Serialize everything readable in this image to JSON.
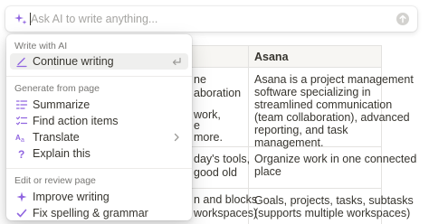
{
  "ai_bar": {
    "placeholder": "Ask AI to write anything..."
  },
  "colors": {
    "accent": "#9065e0",
    "text": "#37352f",
    "muted": "#787774",
    "hover": "#efefee",
    "border": "#e3e2e0",
    "header_bg": "#f7f6f3"
  },
  "menu": {
    "sections": [
      {
        "title": "Write with AI",
        "items": [
          {
            "label": "Continue writing",
            "icon": "pencil-line-icon",
            "trail": "return-icon"
          }
        ]
      },
      {
        "title": "Generate from page",
        "items": [
          {
            "label": "Summarize",
            "icon": "summary-lines-icon"
          },
          {
            "label": "Find action items",
            "icon": "checklist-icon"
          },
          {
            "label": "Translate",
            "icon": "translate-icon",
            "trail": "chevron-right-icon"
          },
          {
            "label": "Explain this",
            "icon": "question-mark-icon"
          }
        ]
      },
      {
        "title": "Edit or review page",
        "items": [
          {
            "label": "Improve writing",
            "icon": "sparkle-icon"
          },
          {
            "label": "Fix spelling & grammar",
            "icon": "checkmark-icon"
          }
        ]
      }
    ]
  },
  "table": {
    "header_right": "Asana",
    "left_fragments": [
      "ne",
      "aboration",
      "work,",
      "e",
      "more.",
      "day's tools,",
      "good old",
      "n and blocks",
      "workspaces)"
    ],
    "right_rows": [
      [
        "Asana is a project management",
        "software specializing in",
        "streamlined communication",
        "(team collaboration), advanced",
        "reporting, and task",
        "management."
      ],
      [
        "Organize work in one connected",
        "place"
      ],
      [
        "Goals, projects, tasks, subtasks",
        "(supports multiple workspaces)"
      ]
    ]
  }
}
